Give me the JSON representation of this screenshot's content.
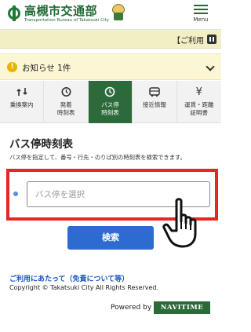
{
  "header": {
    "logo_title": "高槻市交通部",
    "logo_subtitle": "Transportation Bureau of Takatsuki City",
    "menu_label": "Menu"
  },
  "ticker": {
    "text": "【ご利用"
  },
  "notice": {
    "text": "お知らせ 1件"
  },
  "tabs": [
    {
      "label": "乗換案内",
      "icon": "route-icon",
      "active": false
    },
    {
      "label": "発着\n時刻表",
      "icon": "clock-history-icon",
      "active": false
    },
    {
      "label": "バス停\n時刻表",
      "icon": "clock-icon",
      "active": true
    },
    {
      "label": "接近情報",
      "icon": "bus-icon",
      "active": false
    },
    {
      "label": "運賃・距離\n証明書",
      "icon": "yen-icon",
      "active": false
    }
  ],
  "main": {
    "title": "バス停時刻表",
    "instructions": "バス停を指定して、番号・行先・のりば別の時刻表を検索できます。",
    "input_placeholder": "バス停を選択",
    "search_label": "検索"
  },
  "footer": {
    "disclaimer": "ご利用にあたって（免責について等）",
    "copyright": "Copyright © Takatsuki City All Rights Reserved.",
    "powered_by": "Powered by",
    "navitime": "NAVITIME"
  },
  "colors": {
    "brand_green": "#2c6a3a",
    "highlight_red": "#e8251e",
    "button_blue": "#2e6bd0",
    "link_blue": "#1a56c4"
  }
}
